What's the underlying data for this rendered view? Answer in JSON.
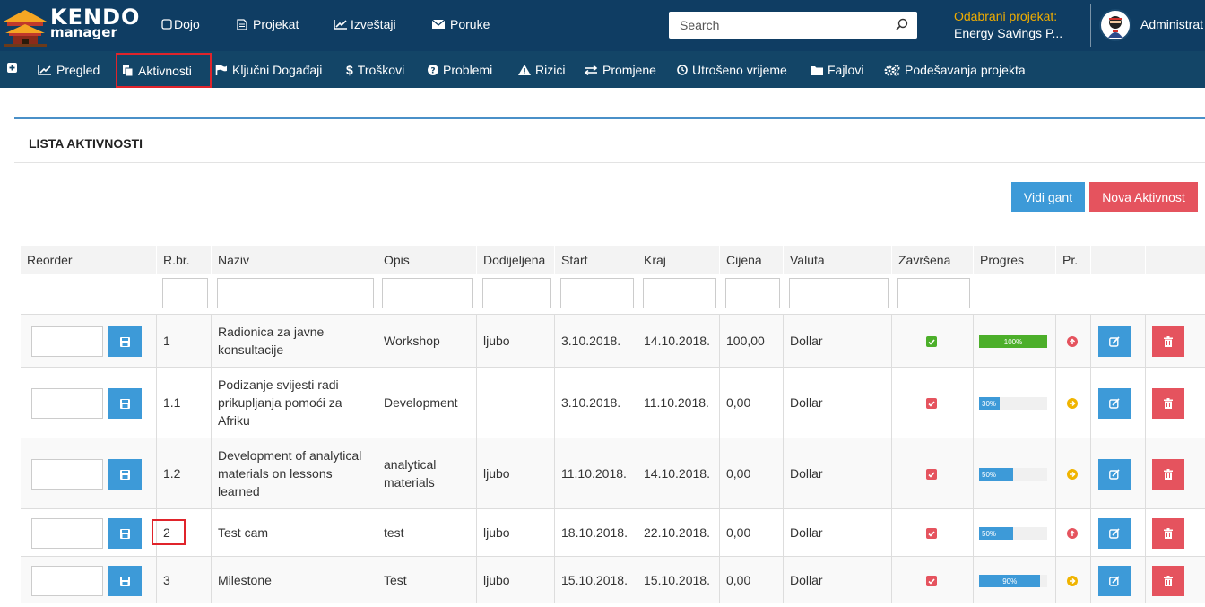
{
  "app": {
    "logo_line1": "KENDO",
    "logo_line2": "manager"
  },
  "topnav": [
    {
      "label": "Dojo",
      "icon": "window-icon"
    },
    {
      "label": "Projekat",
      "icon": "document-icon"
    },
    {
      "label": "Izveštaji",
      "icon": "line-chart-icon"
    },
    {
      "label": "Poruke",
      "icon": "envelope-icon"
    }
  ],
  "search": {
    "placeholder": "Search"
  },
  "project": {
    "label": "Odabrani projekat:",
    "name": "Energy Savings P..."
  },
  "user": {
    "name": "Administrat"
  },
  "subnav": [
    {
      "label": "",
      "icon": "plus-icon"
    },
    {
      "label": "Pregled",
      "icon": "line-chart-icon"
    },
    {
      "label": "Aktivnosti",
      "icon": "copy-icon"
    },
    {
      "label": "Ključni Događaji",
      "icon": "flag-icon"
    },
    {
      "label": "Troškovi",
      "icon": "dollar-icon"
    },
    {
      "label": "Problemi",
      "icon": "question-icon"
    },
    {
      "label": "Rizici",
      "icon": "warning-icon"
    },
    {
      "label": "Promjene",
      "icon": "exchange-icon"
    },
    {
      "label": "Utrošeno vrijeme",
      "icon": "clock-icon"
    },
    {
      "label": "Fajlovi",
      "icon": "folder-icon"
    },
    {
      "label": "Podešavanja projekta",
      "icon": "cogs-icon"
    }
  ],
  "panel": {
    "title": "LISTA AKTIVNOSTI",
    "btn_gant": "Vidi gant",
    "btn_nova": "Nova Aktivnost"
  },
  "table": {
    "headers": [
      "Reorder",
      "R.br.",
      "Naziv",
      "Opis",
      "Dodijeljena",
      "Start",
      "Kraj",
      "Cijena",
      "Valuta",
      "Završena",
      "Progres",
      "Pr.",
      "",
      ""
    ],
    "rows": [
      {
        "rbr": "1",
        "naziv": "Radionica za javne konsultacije",
        "opis": "Workshop",
        "dodijeljena": "ljubo",
        "start": "3.10.2018.",
        "kraj": "14.10.2018.",
        "cijena": "100,00",
        "valuta": "Dollar",
        "zavrsena": true,
        "progres": 100,
        "progres_label": "100%",
        "prioritet": "up"
      },
      {
        "rbr": "1.1",
        "naziv": "Podizanje svijesti radi prikupljanja pomoći za Afriku",
        "opis": "Development",
        "dodijeljena": "",
        "start": "3.10.2018.",
        "kraj": "11.10.2018.",
        "cijena": "0,00",
        "valuta": "Dollar",
        "zavrsena": false,
        "progres": 30,
        "progres_label": "30%",
        "prioritet": "right"
      },
      {
        "rbr": "1.2",
        "naziv": "Development of analytical materials on lessons learned",
        "opis": "analytical materials",
        "dodijeljena": "ljubo",
        "start": "11.10.2018.",
        "kraj": "14.10.2018.",
        "cijena": "0,00",
        "valuta": "Dollar",
        "zavrsena": false,
        "progres": 50,
        "progres_label": "50%",
        "prioritet": "right"
      },
      {
        "rbr": "2",
        "naziv": "Test cam",
        "opis": "test",
        "dodijeljena": "ljubo",
        "start": "18.10.2018.",
        "kraj": "22.10.2018.",
        "cijena": "0,00",
        "valuta": "Dollar",
        "zavrsena": false,
        "progres": 50,
        "progres_label": "50%",
        "prioritet": "up"
      },
      {
        "rbr": "3",
        "naziv": "Milestone",
        "opis": "Test",
        "dodijeljena": "ljubo",
        "start": "15.10.2018.",
        "kraj": "15.10.2018.",
        "cijena": "0,00",
        "valuta": "Dollar",
        "zavrsena": false,
        "progres": 90,
        "progres_label": "90%",
        "prioritet": "right"
      }
    ]
  },
  "colors": {
    "topbar": "#0f3d63",
    "subbar": "#134567",
    "primary": "#3d9ad8",
    "danger": "#e5535e",
    "success": "#4caf2a",
    "warning": "#f0b400",
    "project_label": "#f0ad00",
    "highlight": "#e0242b"
  }
}
